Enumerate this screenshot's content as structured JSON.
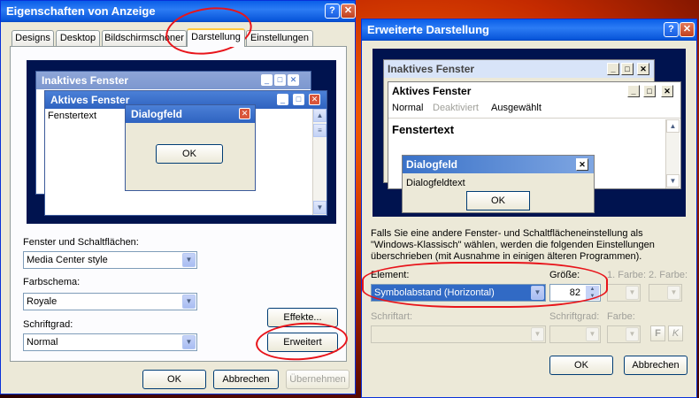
{
  "left_dialog": {
    "title": "Eigenschaften von Anzeige",
    "title_help": "?",
    "title_close": "✕",
    "tabs": [
      "Designs",
      "Desktop",
      "Bildschirmschoner",
      "Darstellung",
      "Einstellungen"
    ],
    "active_tab": "Darstellung",
    "preview": {
      "inactive_title": "Inaktives Fenster",
      "active_title": "Aktives Fenster",
      "window_text": "Fenstertext",
      "dialog_title": "Dialogfeld",
      "dialog_ok": "OK"
    },
    "windows_buttons_label": "Fenster und Schaltflächen:",
    "windows_buttons_value": "Media Center style",
    "color_scheme_label": "Farbschema:",
    "color_scheme_value": "Royale",
    "font_size_label": "Schriftgrad:",
    "font_size_value": "Normal",
    "effects_button": "Effekte...",
    "advanced_button": "Erweitert",
    "ok_button": "OK",
    "cancel_button": "Abbrechen",
    "apply_button": "Übernehmen"
  },
  "right_dialog": {
    "title": "Erweiterte Darstellung",
    "title_help": "?",
    "title_close": "✕",
    "preview": {
      "inactive_title": "Inaktives Fenster",
      "active_title": "Aktives Fenster",
      "menu_normal": "Normal",
      "menu_disabled": "Deaktiviert",
      "menu_selected": "Ausgewählt",
      "window_text": "Fenstertext",
      "dialog_title": "Dialogfeld",
      "dialog_text": "Dialogfeldtext",
      "dialog_ok": "OK"
    },
    "info_text": "Falls Sie eine andere Fenster- und Schaltflächeneinstellung als \"Windows-Klassisch\" wählen, werden die folgenden Einstellungen überschrieben (mit Ausnahme in einigen älteren Programmen).",
    "element_label": "Element:",
    "element_value": "Symbolabstand (Horizontal)",
    "size_label": "Größe:",
    "size_value": "82",
    "color1_label": "1. Farbe:",
    "color2_label": "2. Farbe:",
    "font_label": "Schriftart:",
    "font_size_label": "Schriftgrad:",
    "font_color_label": "Farbe:",
    "bold_label": "F",
    "italic_label": "K",
    "ok_button": "OK",
    "cancel_button": "Abbrechen"
  },
  "colors": {
    "xp_title_blue": "#0a5ee8",
    "dialog_face": "#ece9d8",
    "highlight_blue": "#316ac5",
    "annotation_red": "#e8141a"
  }
}
